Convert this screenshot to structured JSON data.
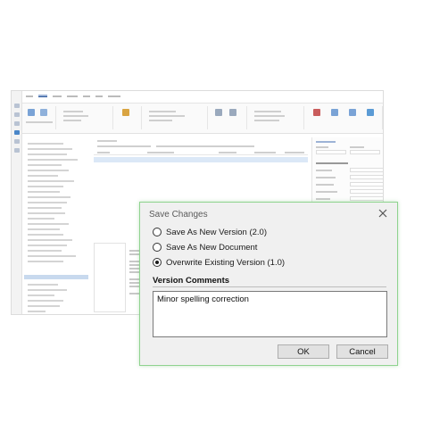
{
  "dialog": {
    "title": "Save Changes",
    "options": [
      {
        "label": "Save As New Version (2.0)",
        "checked": false
      },
      {
        "label": "Save As New Document",
        "checked": false
      },
      {
        "label": "Overwrite Existing Version (1.0)",
        "checked": true
      }
    ],
    "comments_label": "Version Comments",
    "comments_value": "Minor spelling correction",
    "ok_label": "OK",
    "cancel_label": "Cancel"
  },
  "colors": {
    "dialog_bg": "#f0f0f0",
    "dialog_border": "#8fd38f",
    "app_accent": "#2b579a"
  },
  "icons": {
    "close": "close-icon"
  }
}
